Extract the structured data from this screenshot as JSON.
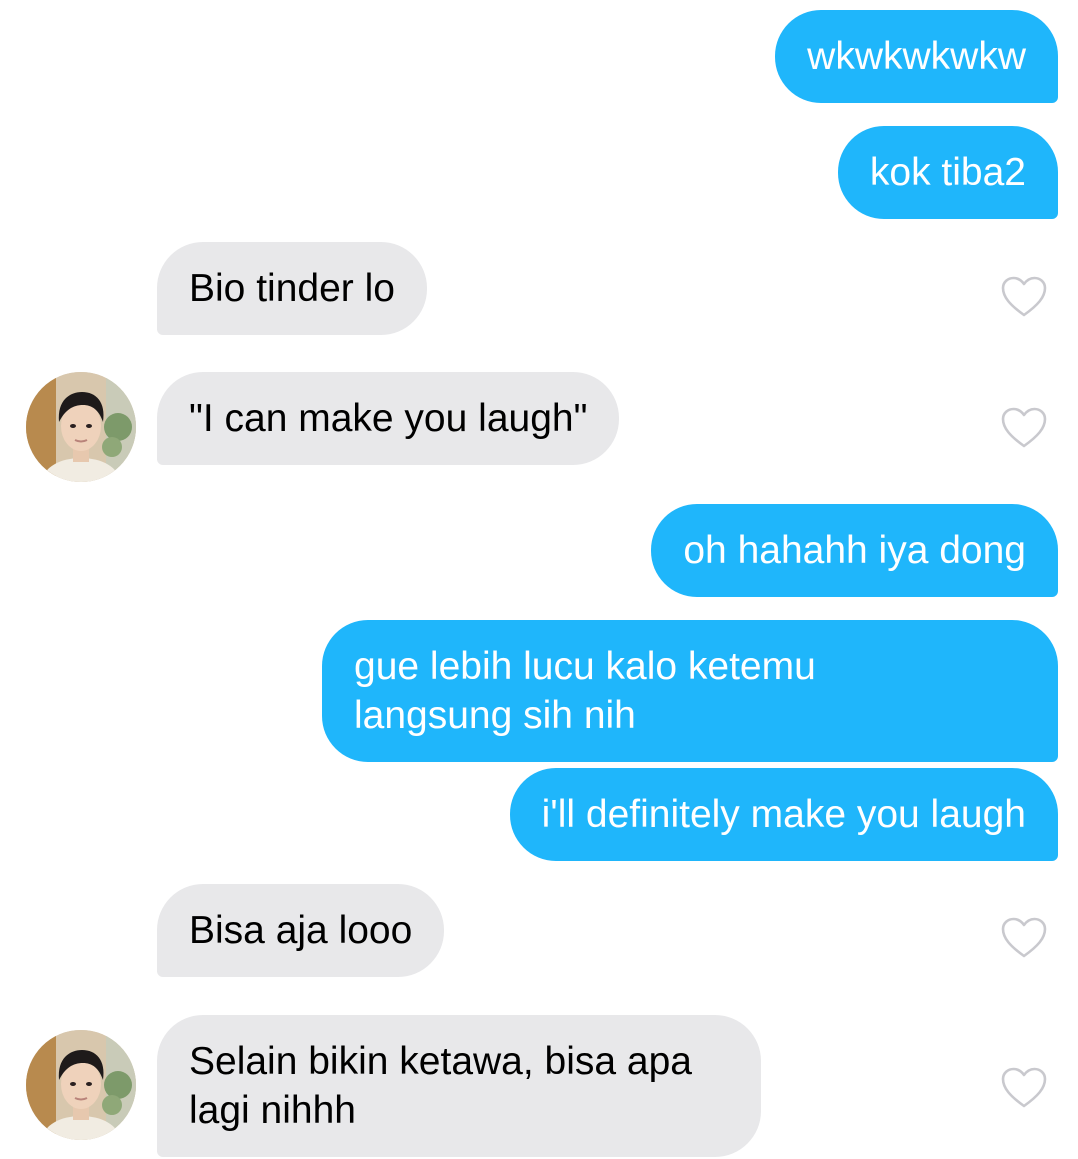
{
  "colors": {
    "sent_bubble": "#1fb6fb",
    "received_bubble": "#e8e8ea",
    "heart_stroke": "#c9c9ce"
  },
  "messages": [
    {
      "from": "me",
      "text": "wkwkwkwkw"
    },
    {
      "from": "me",
      "text": "kok tiba2"
    },
    {
      "from": "match",
      "text": "Bio tinder lo",
      "liked": false
    },
    {
      "from": "match",
      "text": "\"I can make you laugh\"",
      "liked": false
    },
    {
      "from": "me",
      "text": "oh hahahh iya dong"
    },
    {
      "from": "me",
      "text": "gue lebih lucu kalo ketemu\nlangsung sih nih"
    },
    {
      "from": "me",
      "text": "i'll definitely make you laugh"
    },
    {
      "from": "match",
      "text": "Bisa aja looo",
      "liked": false
    },
    {
      "from": "match",
      "text": "Selain bikin ketawa, bisa apa\nlagi nihhh",
      "liked": false
    }
  ],
  "icons": {
    "like": "heart-outline-icon",
    "avatar": "match-profile-photo"
  }
}
